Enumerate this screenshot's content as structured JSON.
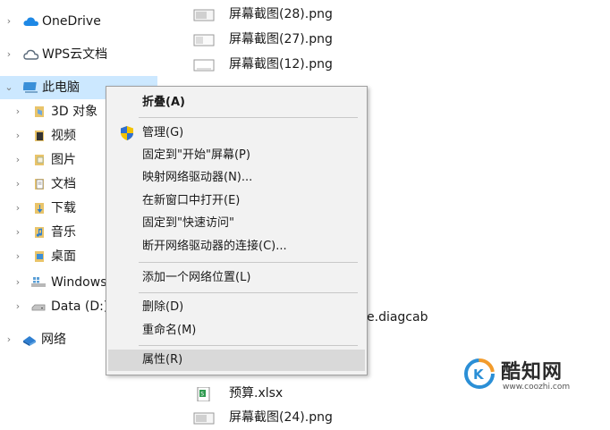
{
  "nav": {
    "items": [
      {
        "label": "OneDrive",
        "icon": "cloud-icon",
        "color": "#1e88e5"
      },
      {
        "label": "WPS云文档",
        "icon": "cloud-outline-icon",
        "color": "#5a6a7a"
      },
      {
        "label": "此电脑",
        "icon": "computer-icon",
        "color": "#3a8fd8",
        "expanded": true
      },
      {
        "label": "3D 对象",
        "icon": "3d-objects-icon",
        "color": "#6fa8dc"
      },
      {
        "label": "视频",
        "icon": "video-folder-icon",
        "color": "#333333"
      },
      {
        "label": "图片",
        "icon": "pictures-folder-icon",
        "color": "#e8c46a"
      },
      {
        "label": "文档",
        "icon": "documents-folder-icon",
        "color": "#8a8a8a"
      },
      {
        "label": "下载",
        "icon": "downloads-folder-icon",
        "color": "#2f7fd1"
      },
      {
        "label": "音乐",
        "icon": "music-folder-icon",
        "color": "#f0a020"
      },
      {
        "label": "桌面",
        "icon": "desktop-folder-icon",
        "color": "#3d8fd6"
      },
      {
        "label": "Windows",
        "icon": "windows-drive-icon",
        "color": "#5a9fd6"
      },
      {
        "label": "Data (D:)",
        "icon": "drive-icon",
        "color": "#888888"
      },
      {
        "label": "网络",
        "icon": "network-icon",
        "color": "#2f7fd1"
      }
    ]
  },
  "files": {
    "top": [
      {
        "name": "屏幕截图(28).png",
        "icon": "png-file-icon"
      },
      {
        "name": "屏幕截图(27).png",
        "icon": "png-file-icon"
      },
      {
        "name": "屏幕截图(12).png",
        "icon": "png-file-icon"
      }
    ],
    "partial_diagcab": "e.diagcab",
    "bottom": [
      {
        "name": "预算.xlsx",
        "icon": "xlsx-file-icon"
      },
      {
        "name": "屏幕截图(24).png",
        "icon": "png-file-icon"
      }
    ]
  },
  "context_menu": {
    "items": [
      {
        "label": "折叠(A)",
        "bold": true
      },
      {
        "label": "管理(G)",
        "icon": "shield-icon"
      },
      {
        "label": "固定到\"开始\"屏幕(P)"
      },
      {
        "label": "映射网络驱动器(N)..."
      },
      {
        "label": "在新窗口中打开(E)"
      },
      {
        "label": "固定到\"快速访问\""
      },
      {
        "label": "断开网络驱动器的连接(C)..."
      },
      {
        "label": "添加一个网络位置(L)"
      },
      {
        "label": "删除(D)"
      },
      {
        "label": "重命名(M)"
      },
      {
        "label": "属性(R)",
        "hovered": true
      }
    ]
  },
  "watermark": {
    "title": "酷知网",
    "url": "www.coozhi.com"
  },
  "colors": {
    "selected_bg": "#cce8ff",
    "menu_bg": "#f2f2f2",
    "menu_hover": "#d9d9d9"
  }
}
